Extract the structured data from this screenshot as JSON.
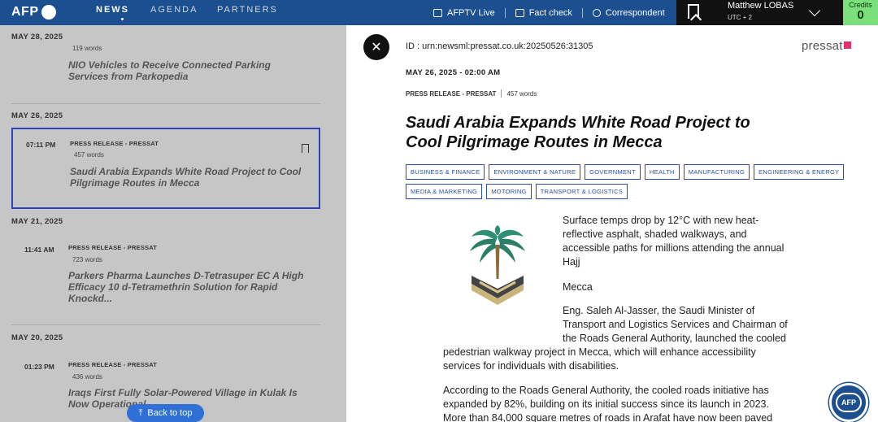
{
  "topbar": {
    "logo_text": "AFP",
    "nav": [
      {
        "label": "NEWS",
        "active": true
      },
      {
        "label": "AGENDA",
        "active": false
      },
      {
        "label": "PARTNERS",
        "active": false
      }
    ],
    "links": [
      {
        "label": "AFPTV Live",
        "icon": "tv-icon"
      },
      {
        "label": "Fact check",
        "icon": "fact-check-icon"
      },
      {
        "label": "Correspondent",
        "icon": "lightbulb-icon"
      }
    ],
    "user_name": "Matthew LOBAS",
    "user_tz": "UTC + 2",
    "credits_label": "Credits",
    "credits_value": "0"
  },
  "news_list": {
    "groups": [
      {
        "date": "MAY 28, 2025",
        "items": [
          {
            "words": "119 words",
            "title": "NIO Vehicles to Receive Connected Parking Services from Parkopedia"
          }
        ]
      },
      {
        "date": "MAY 26, 2025",
        "items": [
          {
            "time": "07:11 PM",
            "type": "PRESS RELEASE - PRESSAT",
            "words": "457 words",
            "title": "Saudi Arabia Expands White Road Project to Cool Pilgrimage Routes in Mecca",
            "selected": true
          }
        ]
      },
      {
        "date": "MAY 21, 2025",
        "items": [
          {
            "time": "11:41 AM",
            "type": "PRESS RELEASE - PRESSAT",
            "words": "723 words",
            "title": "Parkers Pharma Launches D-Tetrasuper EC A High Efficacy 10 d-Tetramethrin Solution for Rapid Knockd..."
          }
        ]
      },
      {
        "date": "MAY 20, 2025",
        "items": [
          {
            "time": "01:23 PM",
            "type": "PRESS RELEASE - PRESSAT",
            "words": "436 words",
            "title": "Iraqs First Fully Solar-Powered Village in Kulak Is Now Operational"
          }
        ]
      }
    ],
    "back_to_top": "Back to top"
  },
  "article": {
    "id": "ID : urn:newsml:pressat.co.uk:20250526:31305",
    "brand": "pressat",
    "date": "MAY 26, 2025 - 02:00 AM",
    "type": "PRESS RELEASE - PRESSAT",
    "words": "457 words",
    "headline": "Saudi Arabia Expands White Road Project to Cool Pilgrimage Routes in Mecca",
    "tags": [
      "BUSINESS & FINANCE",
      "ENVIRONMENT & NATURE",
      "GOVERNMENT",
      "HEALTH",
      "MANUFACTURING",
      "ENGINEERING & ENERGY",
      "MEDIA & MARKETING",
      "MOTORING",
      "TRANSPORT & LOGISTICS"
    ],
    "p1": "Surface temps drop by 12°C with new heat-reflective asphalt, shaded walkways, and accessible paths for millions attending the annual Hajj",
    "p2": "Mecca",
    "p3a": "Eng. Saleh Al-Jasser, the Saudi Minister of Transport and Logistics Services and Chairman of the Roads General Authority, launched the cooled",
    "p3b": "pedestrian walkway project in Mecca, which will enhance accessibility services for individuals with disabilities.",
    "p4": "According to the Roads General Authority, the cooled roads initiative has expanded by 82%, building on its initial success since its launch in 2023. More than 84,000 square metres of roads in Arafat have now been paved using"
  },
  "fab_label": "AFP",
  "colors": {
    "topbar": "#1b4f8f",
    "credits": "#7be07b",
    "selection": "#2a42b8",
    "tag": "#2a4db0",
    "back_to_top": "#2f6fd6"
  }
}
